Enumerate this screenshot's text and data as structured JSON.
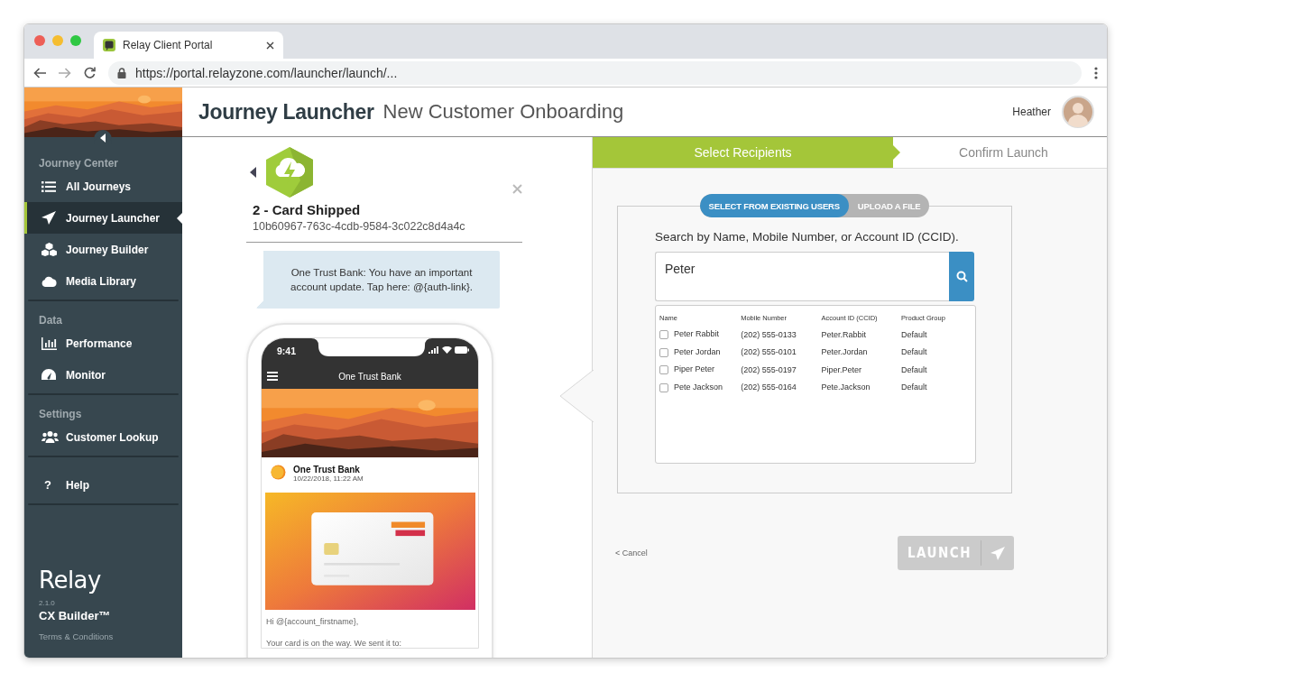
{
  "browser": {
    "tab_title": "Relay Client Portal",
    "url": "https://portal.relayzone.com/launcher/launch/..."
  },
  "sidebar": {
    "sections": [
      {
        "heading": "Journey Center",
        "items": [
          {
            "label": "All Journeys",
            "selected": false
          },
          {
            "label": "Journey Launcher",
            "selected": true
          },
          {
            "label": "Journey Builder",
            "selected": false
          },
          {
            "label": "Media Library",
            "selected": false
          }
        ]
      },
      {
        "heading": "Data",
        "items": [
          {
            "label": "Performance",
            "selected": false
          },
          {
            "label": "Monitor",
            "selected": false
          }
        ]
      },
      {
        "heading": "Settings",
        "items": [
          {
            "label": "Customer Lookup",
            "selected": false
          }
        ]
      },
      {
        "items": [
          {
            "label": "Help",
            "glyph": "?",
            "selected": false
          }
        ]
      }
    ],
    "footer": {
      "logo": "Relay",
      "version": "2.1.0",
      "product": "CX Builder™",
      "terms": "Terms & Conditions"
    }
  },
  "header": {
    "title": "Journey Launcher",
    "subtitle": "New Customer Onboarding",
    "user": "Heather"
  },
  "journey": {
    "title": "2 - Card Shipped",
    "id": "10b60967-763c-4cdb-9584-3c022c8d4a4c",
    "sms": "One Trust Bank: You have an important account update. Tap here: @{auth-link}.",
    "phone": {
      "time": "9:41",
      "app_title": "One Trust Bank",
      "sender": "One Trust Bank",
      "date": "10/22/2018, 11:22 AM",
      "body": [
        "Hi @{account_firstname},",
        "Your card is on the way. We sent it to:"
      ]
    }
  },
  "steps": [
    {
      "label": "Select Recipients",
      "selected": true
    },
    {
      "label": "Confirm Launch",
      "selected": false
    }
  ],
  "source_toggle": [
    {
      "label": "SELECT FROM EXISTING USERS",
      "selected": true
    },
    {
      "label": "UPLOAD A FILE",
      "selected": false
    }
  ],
  "search": {
    "prompt": "Search by Name, Mobile Number, or Account ID (CCID).",
    "value": "Peter"
  },
  "table": {
    "columns": [
      "Name",
      "Mobile Number",
      "Account ID (CCID)",
      "Product Group"
    ],
    "rows": [
      {
        "checked": false,
        "cells": [
          "Peter Rabbit",
          "(202) 555-0133",
          "Peter.Rabbit",
          "Default"
        ]
      },
      {
        "checked": false,
        "cells": [
          "Peter Jordan",
          "(202) 555-0101",
          "Peter.Jordan",
          "Default"
        ]
      },
      {
        "checked": false,
        "cells": [
          "Piper Peter",
          "(202) 555-0197",
          "Piper.Peter",
          "Default"
        ]
      },
      {
        "checked": false,
        "cells": [
          "Pete Jackson",
          "(202) 555-0164",
          "Pete.Jackson",
          "Default"
        ]
      }
    ]
  },
  "cancel": "< Cancel",
  "launch": {
    "label": "LAUNCH",
    "disabled": true
  }
}
